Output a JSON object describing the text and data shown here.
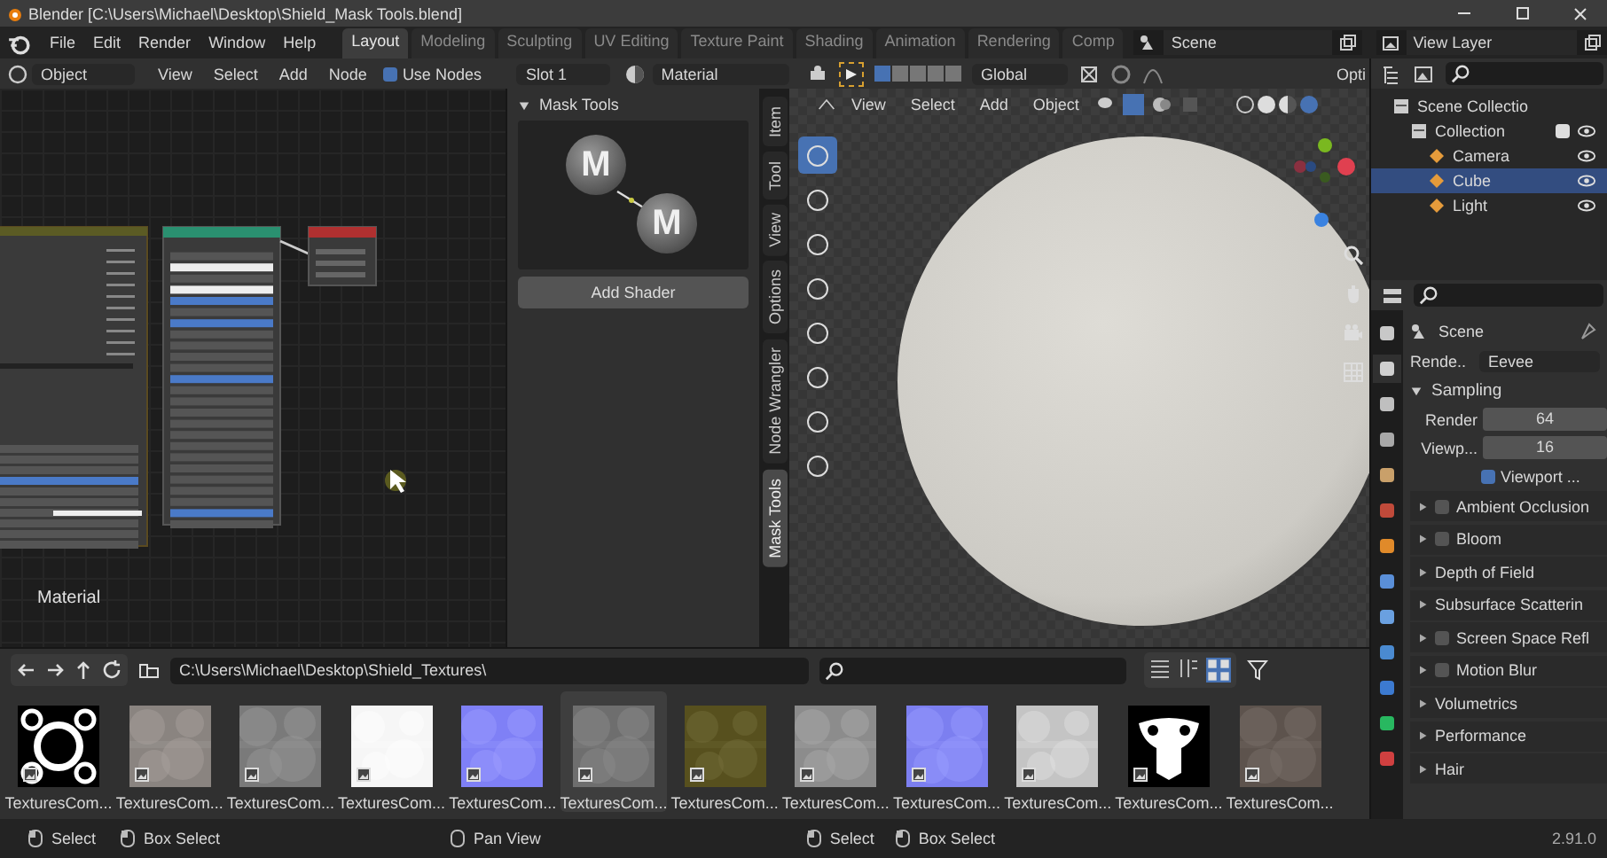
{
  "window": {
    "title": "Blender [C:\\Users\\Michael\\Desktop\\Shield_Mask Tools.blend]"
  },
  "menu": [
    "File",
    "Edit",
    "Render",
    "Window",
    "Help"
  ],
  "workspaces": [
    {
      "label": "Layout",
      "selected": true
    },
    {
      "label": "Modeling",
      "selected": false
    },
    {
      "label": "Sculpting",
      "selected": false
    },
    {
      "label": "UV Editing",
      "selected": false
    },
    {
      "label": "Texture Paint",
      "selected": false
    },
    {
      "label": "Shading",
      "selected": false
    },
    {
      "label": "Animation",
      "selected": false
    },
    {
      "label": "Rendering",
      "selected": false
    },
    {
      "label": "Comp",
      "selected": false
    }
  ],
  "scene": "Scene",
  "view_layer": "View Layer",
  "node_editor": {
    "mode": "Object",
    "menus": [
      "View",
      "Select",
      "Add",
      "Node"
    ],
    "use_nodes": {
      "label": "Use Nodes",
      "checked": true
    },
    "slot": "Slot 1",
    "material": "Material",
    "label": "Material"
  },
  "sidebar": {
    "panel": "Mask Tools",
    "expanded": true,
    "logo_letters": [
      "M",
      "M"
    ],
    "button": "Add Shader",
    "tabs": [
      {
        "label": "Item",
        "selected": false
      },
      {
        "label": "Tool",
        "selected": false
      },
      {
        "label": "View",
        "selected": false
      },
      {
        "label": "Options",
        "selected": false
      },
      {
        "label": "Node Wrangler",
        "selected": false
      },
      {
        "label": "Mask Tools",
        "selected": true
      }
    ]
  },
  "viewport": {
    "transform": "Global",
    "options": "Opti",
    "menus": [
      "View",
      "Select",
      "Add",
      "Object"
    ]
  },
  "outliner": {
    "items": [
      {
        "label": "Scene Collectio",
        "selected": false,
        "children": [
          {
            "label": "Collection",
            "selected": false,
            "checked": true,
            "children": [
              {
                "label": "Camera",
                "selected": false,
                "color": "#e59b3b"
              },
              {
                "label": "Cube",
                "selected": true,
                "color": "#e59b3b"
              },
              {
                "label": "Light",
                "selected": false,
                "color": "#e59b3b"
              }
            ]
          }
        ]
      }
    ]
  },
  "properties": {
    "context": "Scene",
    "engine_label": "Rende..",
    "engine": "Eevee",
    "sampling": {
      "title": "Sampling",
      "expanded": true,
      "fields": [
        {
          "label": "Render",
          "value": "64"
        },
        {
          "label": "Viewp...",
          "value": "16"
        }
      ],
      "denoise": {
        "label": "Viewport ...",
        "checked": true
      }
    },
    "panels": [
      {
        "label": "Ambient Occlusion",
        "kind": "toggle",
        "checked": false,
        "expanded": false
      },
      {
        "label": "Bloom",
        "kind": "toggle",
        "checked": false,
        "expanded": false
      },
      {
        "label": "Depth of Field",
        "kind": "plain",
        "expanded": false
      },
      {
        "label": "Subsurface Scatterin",
        "kind": "plain",
        "expanded": false
      },
      {
        "label": "Screen Space Refl",
        "kind": "toggle",
        "checked": false,
        "expanded": false
      },
      {
        "label": "Motion Blur",
        "kind": "toggle",
        "checked": false,
        "expanded": false
      },
      {
        "label": "Volumetrics",
        "kind": "plain",
        "expanded": false
      },
      {
        "label": "Performance",
        "kind": "plain",
        "expanded": false
      },
      {
        "label": "Hair",
        "kind": "plain",
        "expanded": false
      }
    ]
  },
  "file_browser": {
    "path": "C:\\Users\\Michael\\Desktop\\Shield_Textures\\",
    "files": [
      {
        "name": "TexturesCom...",
        "kind": "emblem",
        "color": "#000000",
        "selected": false
      },
      {
        "name": "TexturesCom...",
        "kind": "texture",
        "color": "#8a8480",
        "selected": false
      },
      {
        "name": "TexturesCom...",
        "kind": "texture",
        "color": "#7a7a7a",
        "selected": false
      },
      {
        "name": "TexturesCom...",
        "kind": "texture",
        "color": "#f6f6f6",
        "selected": false
      },
      {
        "name": "TexturesCom...",
        "kind": "texture",
        "color": "#7f80f6",
        "selected": false
      },
      {
        "name": "TexturesCom...",
        "kind": "texture",
        "color": "#6e6e6e",
        "selected": true
      },
      {
        "name": "TexturesCom...",
        "kind": "texture",
        "color": "#57501e",
        "selected": false
      },
      {
        "name": "TexturesCom...",
        "kind": "texture",
        "color": "#8c8c8c",
        "selected": false
      },
      {
        "name": "TexturesCom...",
        "kind": "texture",
        "color": "#7c7ff0",
        "selected": false
      },
      {
        "name": "TexturesCom...",
        "kind": "texture",
        "color": "#c4c4c4",
        "selected": false
      },
      {
        "name": "TexturesCom...",
        "kind": "crest",
        "color": "#000000",
        "selected": false
      },
      {
        "name": "TexturesCom...",
        "kind": "texture",
        "color": "#5d534d",
        "selected": false
      }
    ]
  },
  "status_bar": {
    "items": [
      "Select",
      "Box Select",
      "Pan View",
      "Select",
      "Box Select"
    ],
    "version": "2.91.0"
  }
}
